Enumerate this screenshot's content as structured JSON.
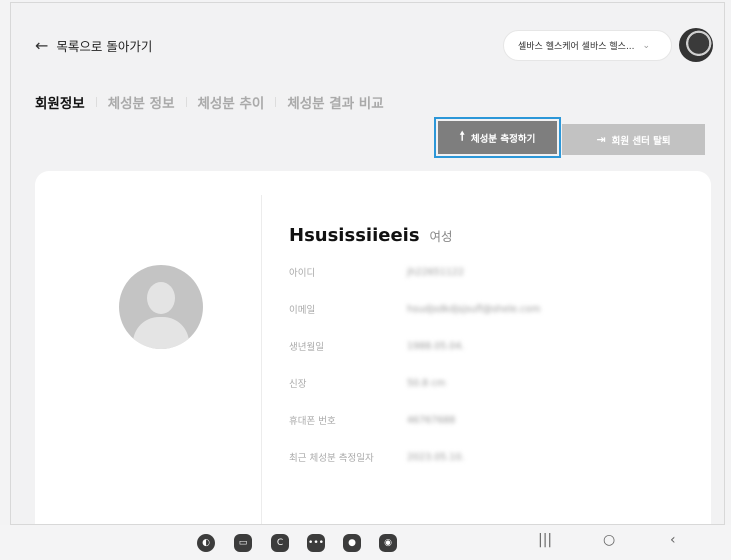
{
  "header": {
    "back_label": "목록으로 돌아가기",
    "org_select_value": "셀바스 헬스케어 셀바스 헬스...",
    "chevron": "⌄"
  },
  "tabs": [
    {
      "label": "회원정보",
      "active": true
    },
    {
      "label": "체성분 정보",
      "active": false
    },
    {
      "label": "체성분 추이",
      "active": false
    },
    {
      "label": "체성분 결과 비교",
      "active": false
    }
  ],
  "actions": {
    "measure_label": "체성분 측정하기",
    "withdraw_label": "회원 센터 탈퇴"
  },
  "profile": {
    "name": "Hsusissiieeis",
    "gender": "여성",
    "fields": [
      {
        "label": "아이디",
        "value": "jh22651122"
      },
      {
        "label": "이메일",
        "value": "hsudjsdkdjsjsufl@shele.com"
      },
      {
        "label": "생년월일",
        "value": "1988.05.04."
      },
      {
        "label": "신장",
        "value": "50.8 cm"
      },
      {
        "label": "휴대폰 번호",
        "value": "46767688"
      },
      {
        "label": "최근 체성분 측정일자",
        "value": "2023.05.10."
      }
    ]
  },
  "navbar": {
    "apps": [
      "browser-icon",
      "folder-icon",
      "app-c-icon",
      "chat-icon",
      "contacts-icon",
      "camera-icon"
    ],
    "system": [
      "recents-icon",
      "home-icon",
      "back-icon"
    ]
  },
  "colors": {
    "accent_outline": "#2c97d8",
    "measure_button": "#7e7e7e",
    "withdraw_button": "#c2c2c2"
  }
}
